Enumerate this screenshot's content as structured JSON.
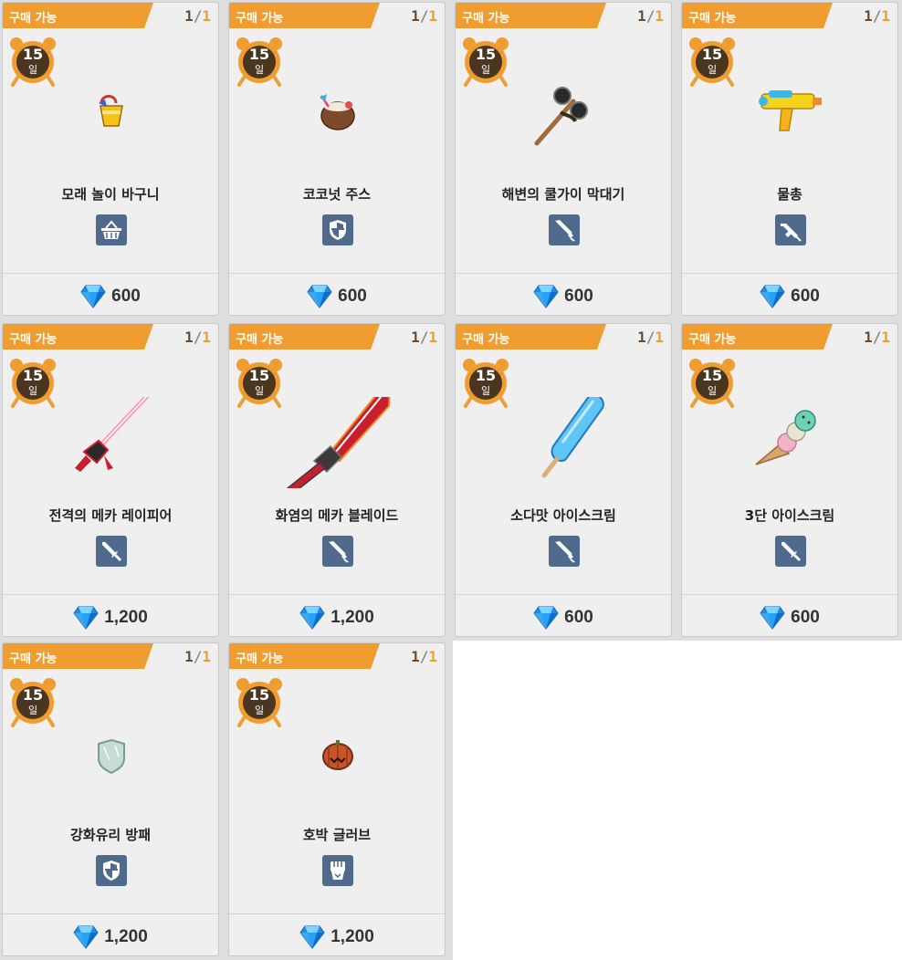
{
  "status_label": "구매 가능",
  "duration": {
    "value": "15",
    "unit": "일"
  },
  "items": [
    {
      "name": "모래 놀이 바구니",
      "purchased": "1",
      "limit": "1",
      "type_icon": "basket-icon",
      "price": "600",
      "image": "sand-bucket"
    },
    {
      "name": "코코넛 주스",
      "purchased": "1",
      "limit": "1",
      "type_icon": "shield-icon",
      "price": "600",
      "image": "coconut-juice"
    },
    {
      "name": "해변의 쿨가이 막대기",
      "purchased": "1",
      "limit": "1",
      "type_icon": "blade-icon",
      "price": "600",
      "image": "sunglasses-stick"
    },
    {
      "name": "물총",
      "purchased": "1",
      "limit": "1",
      "type_icon": "gun-icon",
      "price": "600",
      "image": "water-gun"
    },
    {
      "name": "전격의 메카 레이피어",
      "purchased": "1",
      "limit": "1",
      "type_icon": "sword-icon",
      "price": "1,200",
      "image": "mecha-rapier"
    },
    {
      "name": "화염의 메카 블레이드",
      "purchased": "1",
      "limit": "1",
      "type_icon": "blade-icon",
      "price": "1,200",
      "image": "mecha-blade"
    },
    {
      "name": "소다맛 아이스크림",
      "purchased": "1",
      "limit": "1",
      "type_icon": "blade-icon",
      "price": "600",
      "image": "soda-popsicle"
    },
    {
      "name": "3단 아이스크림",
      "purchased": "1",
      "limit": "1",
      "type_icon": "sword-icon",
      "price": "600",
      "image": "triple-icecream"
    },
    {
      "name": "강화유리 방패",
      "purchased": "1",
      "limit": "1",
      "type_icon": "shield-icon",
      "price": "1,200",
      "image": "glass-shield"
    },
    {
      "name": "호박 글러브",
      "purchased": "1",
      "limit": "1",
      "type_icon": "fist-icon",
      "price": "1,200",
      "image": "pumpkin-glove"
    }
  ],
  "colors": {
    "banner": "#ef9d31",
    "badge": "#4f6a8c",
    "gem": "#1e8fe6"
  }
}
